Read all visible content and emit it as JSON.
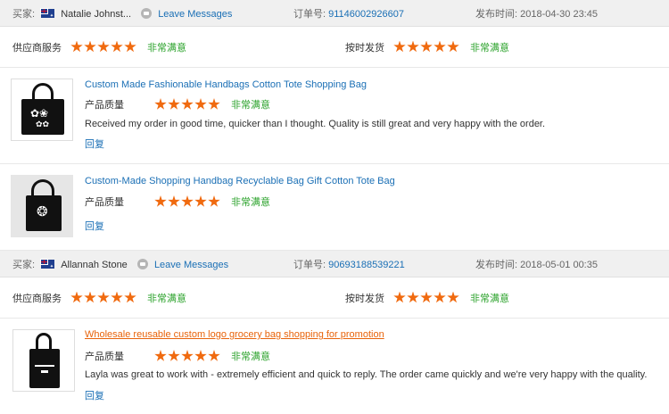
{
  "labels": {
    "buyer": "买家:",
    "leave_messages": "Leave Messages",
    "order_number": "订单号:",
    "posted_time": "发布时间:",
    "supplier_service": "供应商服务",
    "on_time_shipping": "按时发货",
    "product_quality": "产品质量",
    "very_satisfied": "非常满意",
    "reply": "回复"
  },
  "colors": {
    "star": "#f06a0f",
    "link": "#1a6fb5",
    "satisfied": "#2aa22a",
    "highlight_title": "#e8630a"
  },
  "reviews": [
    {
      "buyer_name": "Natalie Johnst...",
      "buyer_flag": "australia-flag-icon",
      "order_number": "91146002926607",
      "posted_time": "2018-04-30 23:45",
      "supplier_service_stars": 5,
      "on_time_shipping_stars": 5,
      "products": [
        {
          "title": "Custom Made Fashionable Handbags Cotton Tote Shopping Bag",
          "quality_stars": 5,
          "comment": "Received my order in good time, quicker than I thought. Quality is still great and very happy with the order.",
          "thumbnail": "black-tote-bag-floral-print"
        },
        {
          "title": "Custom-Made Shopping Handbag Recyclable Bag Gift Cotton Tote Bag",
          "quality_stars": 5,
          "comment": "",
          "thumbnail": "black-tote-bag-mandala-print"
        }
      ]
    },
    {
      "buyer_name": "Allannah Stone",
      "buyer_flag": "australia-flag-icon",
      "order_number": "90693188539221",
      "posted_time": "2018-05-01 00:35",
      "supplier_service_stars": 5,
      "on_time_shipping_stars": 5,
      "products": [
        {
          "title": "Wholesale reusable custom logo grocery bag shopping for promotion",
          "quality_stars": 5,
          "comment": "Layla was great to work with - extremely efficient and quick to reply. The order came quickly and we're very happy with the quality.",
          "thumbnail": "black-tote-bag-logo-print"
        }
      ]
    }
  ]
}
